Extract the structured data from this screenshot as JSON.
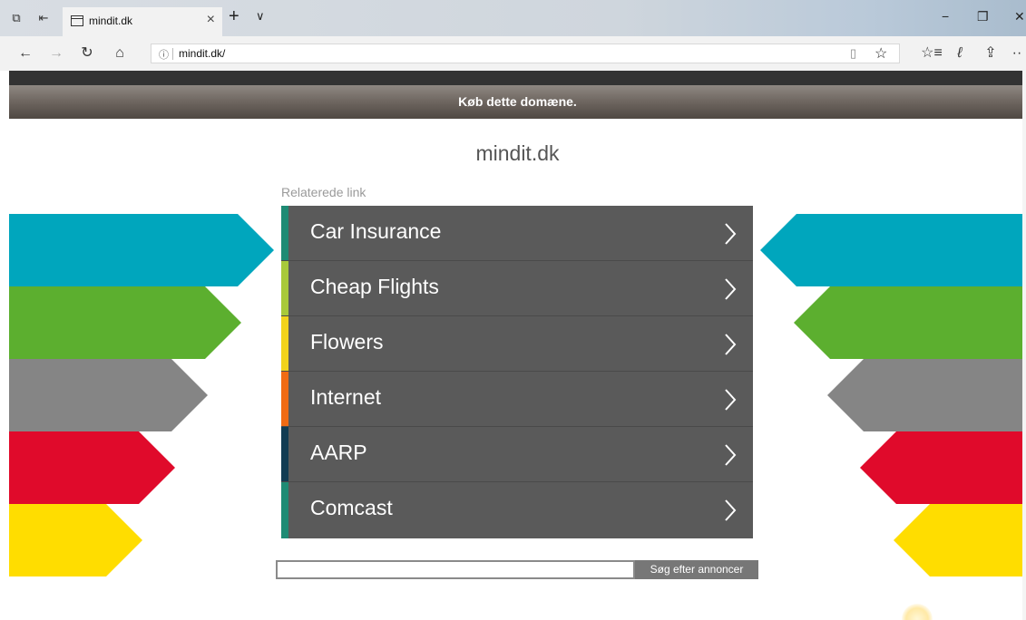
{
  "browser": {
    "tab_title": "mindit.dk",
    "tab_close": "×",
    "new_tab": "+",
    "tab_menu": "∨",
    "address": "mindit.dk/",
    "window": {
      "minimize": "−",
      "restore": "❐",
      "close": "✕"
    },
    "nav": {
      "back": "←",
      "forward": "→",
      "refresh": "↻",
      "home": "⌂"
    },
    "toolbar": {
      "reading_view": "▯",
      "favorite": "☆",
      "favorites_hub": "☆≡",
      "notes": "ℓ",
      "share": "⇪",
      "more": "··"
    }
  },
  "page": {
    "banner": "Køb dette domæne.",
    "domain_title": "mindit.dk",
    "related_label": "Relaterede link",
    "links": [
      {
        "label": "Car Insurance",
        "accent": "#1e8b74"
      },
      {
        "label": "Cheap Flights",
        "accent": "#a8c93a"
      },
      {
        "label": "Flowers",
        "accent": "#f2d31b"
      },
      {
        "label": "Internet",
        "accent": "#f06b14"
      },
      {
        "label": "AARP",
        "accent": "#123c52"
      },
      {
        "label": "Comcast",
        "accent": "#1e8b74"
      }
    ],
    "search": {
      "value": "",
      "button": "Søg efter annoncer"
    },
    "arrow_colors": [
      "#00a6bd",
      "#5caf2f",
      "#858585",
      "#e00a2b",
      "#ffdd00"
    ]
  }
}
